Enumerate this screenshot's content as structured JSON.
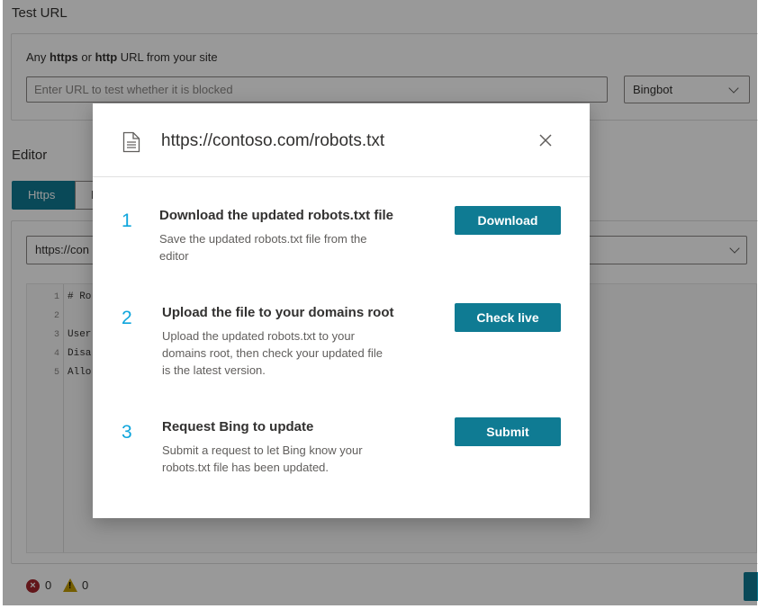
{
  "test_url": {
    "section_title": "Test URL",
    "hint_prefix": "Any ",
    "hint_https": "https",
    "hint_or": " or ",
    "hint_http": "http",
    "hint_suffix": " URL from your site",
    "input_placeholder": "Enter URL to test whether it is blocked",
    "input_value": "",
    "agent_select": "Bingbot"
  },
  "editor": {
    "section_title": "Editor",
    "tabs": [
      "Https",
      "H"
    ],
    "url_select": "https://con",
    "line_numbers": [
      "1",
      "2",
      "3",
      "4",
      "5"
    ],
    "code_lines": [
      "# Ro",
      "",
      "User",
      "Disa",
      "Allo"
    ]
  },
  "status_bar": {
    "errors": "0",
    "warnings": "0"
  },
  "modal": {
    "title": "https://contoso.com/robots.txt",
    "steps": [
      {
        "number": "1",
        "title": "Download the updated robots.txt file",
        "description": [
          "Save the updated robots.txt file from the",
          "editor"
        ],
        "button": "Download"
      },
      {
        "number": "2",
        "title": "Upload the file to your domains root",
        "description": [
          "Upload the updated robots.txt to your",
          "domains root, then check your updated file",
          "is the latest version."
        ],
        "button": "Check live"
      },
      {
        "number": "3",
        "title": "Request Bing to update",
        "description": [
          "Submit a request to let Bing know your",
          "robots.txt file has been updated."
        ],
        "button": "Submit"
      }
    ]
  },
  "colors": {
    "accent": "#0f7b93",
    "step_number": "#0ea5dc",
    "error": "#a4262c",
    "warning": "#c19c00"
  }
}
